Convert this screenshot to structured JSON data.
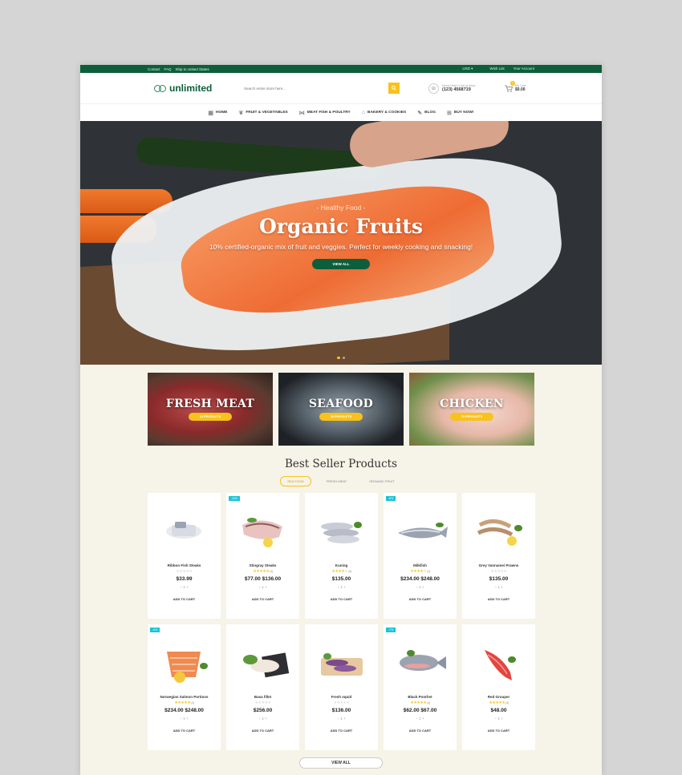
{
  "topbar": {
    "links_left": [
      "Contact",
      "FAQ",
      "Ship to United States"
    ],
    "currency": "USD ▾",
    "wishlist": "Wish List",
    "account": "Your Account"
  },
  "header": {
    "logo_text": "unlimited",
    "search_placeholder": "Search entire store here...",
    "support_label": "Need Help? Call us Now",
    "support_phone": "(123) 4568719",
    "cart_label": "My Cart",
    "cart_total": "$0.00",
    "cart_count": "0"
  },
  "nav": [
    {
      "label": "HOME",
      "icon": "home-icon"
    },
    {
      "label": "FRUIT & VEGETABLES",
      "icon": "fruit-icon"
    },
    {
      "label": "MEAT FISH & POULTRY",
      "icon": "fish-icon"
    },
    {
      "label": "BAKERY & COOKIES",
      "icon": "bakery-icon"
    },
    {
      "label": "BLOG",
      "icon": "blog-icon"
    },
    {
      "label": "BUY NOW!",
      "icon": "cart-icon"
    }
  ],
  "hero": {
    "subtitle": "- Healthy Food -",
    "title": "Organic Fruits",
    "description": "10% certified-organic mix of fruit and veggies. Perfect for weekly cooking and snacking!",
    "cta": "VIEW ALL",
    "active_slide": 1
  },
  "categories": [
    {
      "title": "FRESH MEAT",
      "button": "14 PRODUCTS"
    },
    {
      "title": "SEAFOOD",
      "button": "18 PRODUCTS"
    },
    {
      "title": "CHICKEN",
      "button": "10 PRODUCTS"
    }
  ],
  "section": {
    "title": "Best Seller Products",
    "tabs": [
      "SEA FOOD",
      "FRESH MEAT",
      "ORGANIC FRUIT"
    ],
    "active_tab": 0
  },
  "products": [
    {
      "name": "Ribbon Fish Steaks",
      "price": "$33.99",
      "sale": "",
      "rating": 0,
      "reviews": "",
      "img": "ribbon"
    },
    {
      "name": "Stingray Steaks",
      "price": "$77.00 $136.00",
      "sale": "-44%",
      "rating": 5,
      "reviews": "(1)",
      "img": "stingray"
    },
    {
      "name": "Kuning",
      "price": "$135.00",
      "sale": "",
      "rating": 4,
      "reviews": "(3)",
      "img": "kuning"
    },
    {
      "name": "Milkfish",
      "price": "$234.00 $248.00",
      "sale": "-6%",
      "rating": 4,
      "reviews": "(1)",
      "img": "milkfish"
    },
    {
      "name": "Grey Vannamei Prawns",
      "price": "$135.00",
      "sale": "",
      "rating": 0,
      "reviews": "",
      "img": "prawns"
    },
    {
      "name": "Norwegian Salmon Portions",
      "price": "$234.00 $248.00",
      "sale": "-6%",
      "rating": 5,
      "reviews": "(1)",
      "img": "salmon"
    },
    {
      "name": "Basa fillet",
      "price": "$256.00",
      "sale": "",
      "rating": 0,
      "reviews": "",
      "img": "basa"
    },
    {
      "name": "Fresh squid",
      "price": "$136.00",
      "sale": "",
      "rating": 0,
      "reviews": "",
      "img": "squid"
    },
    {
      "name": "Black Pomfret",
      "price": "$62.00 $67.00",
      "sale": "-7%",
      "rating": 5,
      "reviews": "(1)",
      "img": "pomfret"
    },
    {
      "name": "Red Grouper",
      "price": "$48.00",
      "sale": "",
      "rating": 5,
      "reviews": "(1)",
      "img": "grouper"
    }
  ],
  "product_actions": {
    "qty": "−   1   +",
    "add_to_cart": "ADD TO CART"
  },
  "view_all": "VIEW ALL",
  "colors": {
    "brand": "#0c5f3a",
    "accent": "#f8c21c",
    "sale": "#18c5d6"
  }
}
